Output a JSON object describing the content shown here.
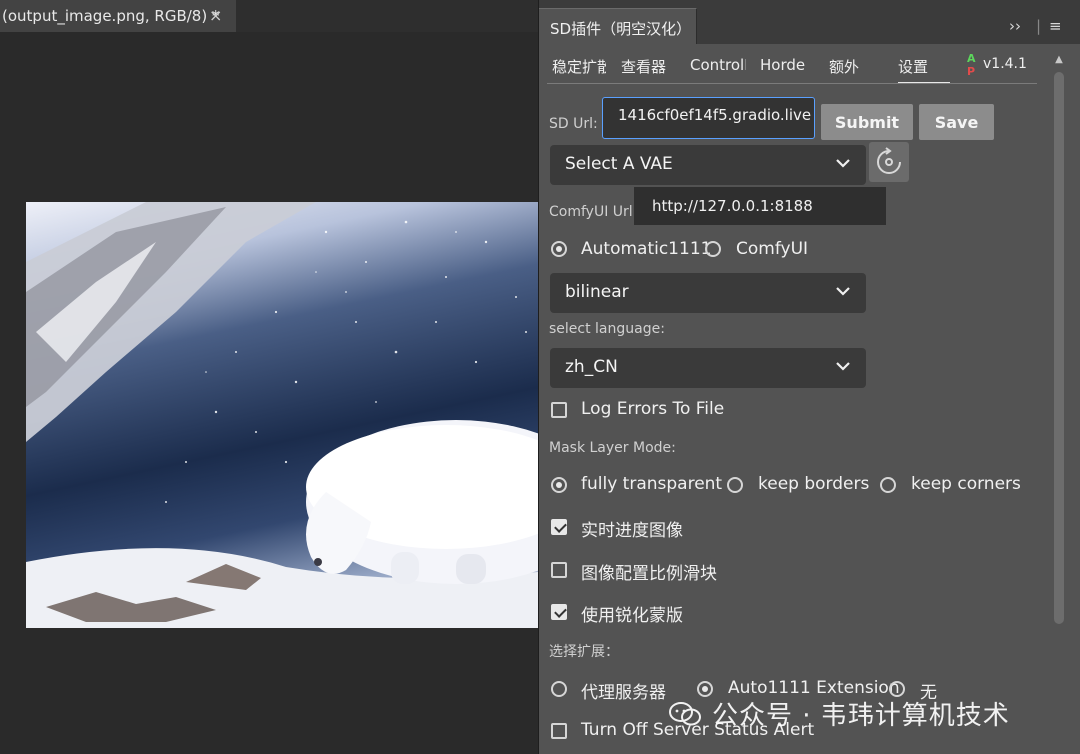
{
  "document": {
    "tab_title": "(output_image.png, RGB/8) *",
    "close": "×"
  },
  "panel": {
    "title": "SD插件（明空汉化）",
    "expand_icon": "››",
    "menu_icon": "≡",
    "tabs": [
      "稳定扩散",
      "查看器",
      "ControlNet",
      "Horde",
      "额外",
      "设置"
    ],
    "active_tab": "设置",
    "ap_logo": {
      "a": "A",
      "p": "P"
    },
    "version": "v1.4.1"
  },
  "settings": {
    "sd_url_label": "SD Url:",
    "sd_url_value": "1416cf0ef14f5.gradio.live",
    "submit_label": "Submit",
    "save_label": "Save",
    "vae_select": "Select A VAE",
    "comfyui_url_label": "ComfyUI Url:",
    "comfyui_url_tooltip": "http://127.0.0.1:8188",
    "backend_options": [
      "Automatic1111",
      "ComfyUI"
    ],
    "backend_selected": "Automatic1111",
    "sampler_select": "bilinear",
    "language_label": "select language:",
    "language_select": "zh_CN",
    "log_errors_label": "Log Errors To File",
    "mask_mode_label": "Mask Layer Mode:",
    "mask_modes": [
      "fully transparent",
      "keep borders",
      "keep corners"
    ],
    "mask_mode_selected": "fully transparent",
    "realtime_progress": "实时进度图像",
    "ratio_slider": "图像配置比例滑块",
    "sharpen_mask": "使用锐化蒙版",
    "extension_label": "选择扩展：",
    "extension_options": [
      "代理服务器",
      "Auto1111 Extension",
      "无"
    ],
    "extension_selected": "Auto1111 Extension",
    "server_alert": "Turn Off Server Status Alert"
  },
  "watermark": "公众号 · 韦玮计算机技术",
  "colors": {
    "panel_bg": "#535353",
    "input_focus": "#5aa0ff",
    "button_bg": "#8c8c8c",
    "canvas_bg": "#2a2a2a"
  }
}
